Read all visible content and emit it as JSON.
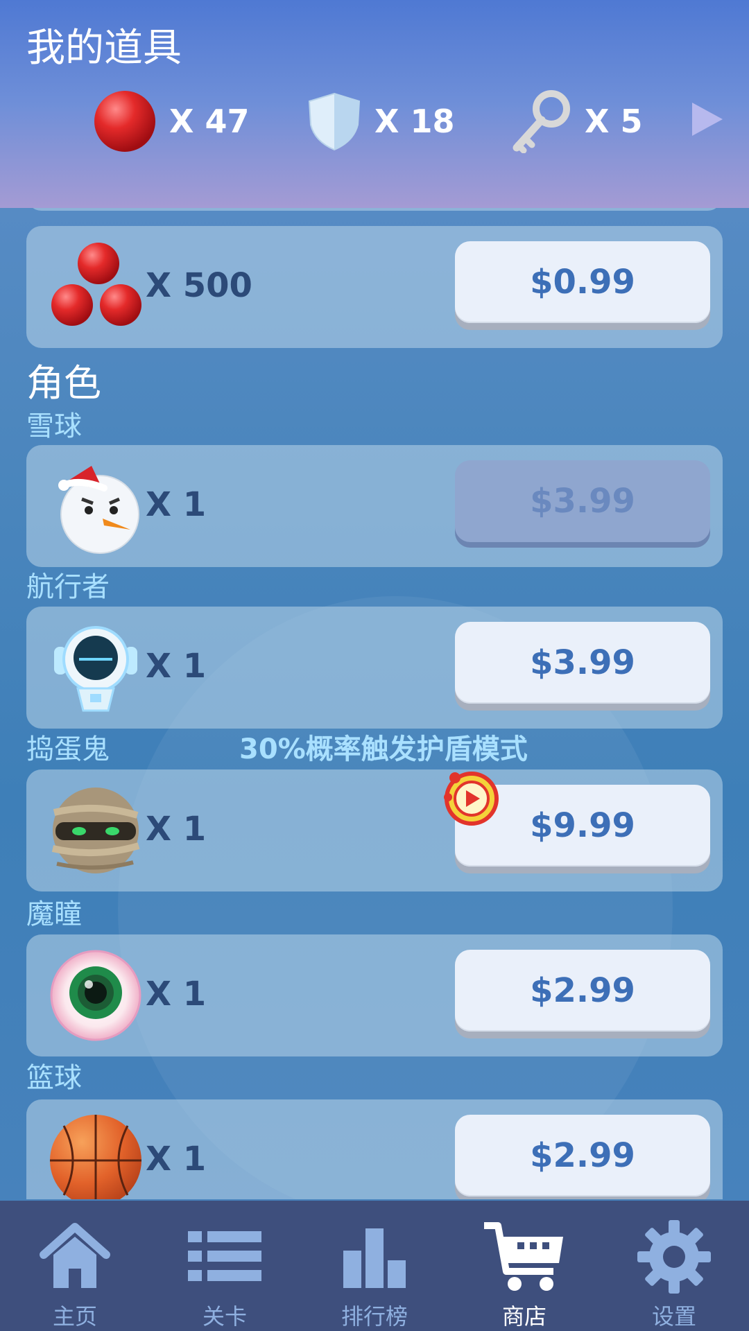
{
  "header": {
    "title": "我的道具",
    "inventory": [
      {
        "icon": "red-ball-icon",
        "count": "X 47"
      },
      {
        "icon": "shield-icon",
        "count": "X 18"
      },
      {
        "icon": "key-icon",
        "count": "X 5"
      }
    ]
  },
  "shop": {
    "top_item": {
      "icon": "red-balls-icon",
      "qty": "X 500",
      "price": "$0.99"
    },
    "section_title": "角色",
    "items": [
      {
        "name": "雪球",
        "icon": "snowman-icon",
        "qty": "X 1",
        "price": "$3.99",
        "disabled": true
      },
      {
        "name": "航行者",
        "icon": "robot-icon",
        "qty": "X 1",
        "price": "$3.99"
      },
      {
        "name": "捣蛋鬼",
        "note": "30%概率触发护盾模式",
        "icon": "mummy-icon",
        "qty": "X 1",
        "price": "$9.99",
        "badge": "video-ad-icon"
      },
      {
        "name": "魔瞳",
        "icon": "eyeball-icon",
        "qty": "X 1",
        "price": "$2.99"
      },
      {
        "name": "篮球",
        "icon": "basketball-icon",
        "qty": "X 1",
        "price": "$2.99"
      }
    ]
  },
  "tabs": [
    {
      "label": "主页",
      "icon": "home-icon"
    },
    {
      "label": "关卡",
      "icon": "list-icon"
    },
    {
      "label": "排行榜",
      "icon": "bar-chart-icon"
    },
    {
      "label": "商店",
      "icon": "cart-icon",
      "active": true
    },
    {
      "label": "设置",
      "icon": "gear-icon"
    }
  ],
  "colors": {
    "header_top": "#4f79d3",
    "header_bottom": "#a49bd4",
    "tabbar": "#3e4f7d",
    "price_text": "#3d6fb7",
    "label": "#a9e0ff"
  }
}
